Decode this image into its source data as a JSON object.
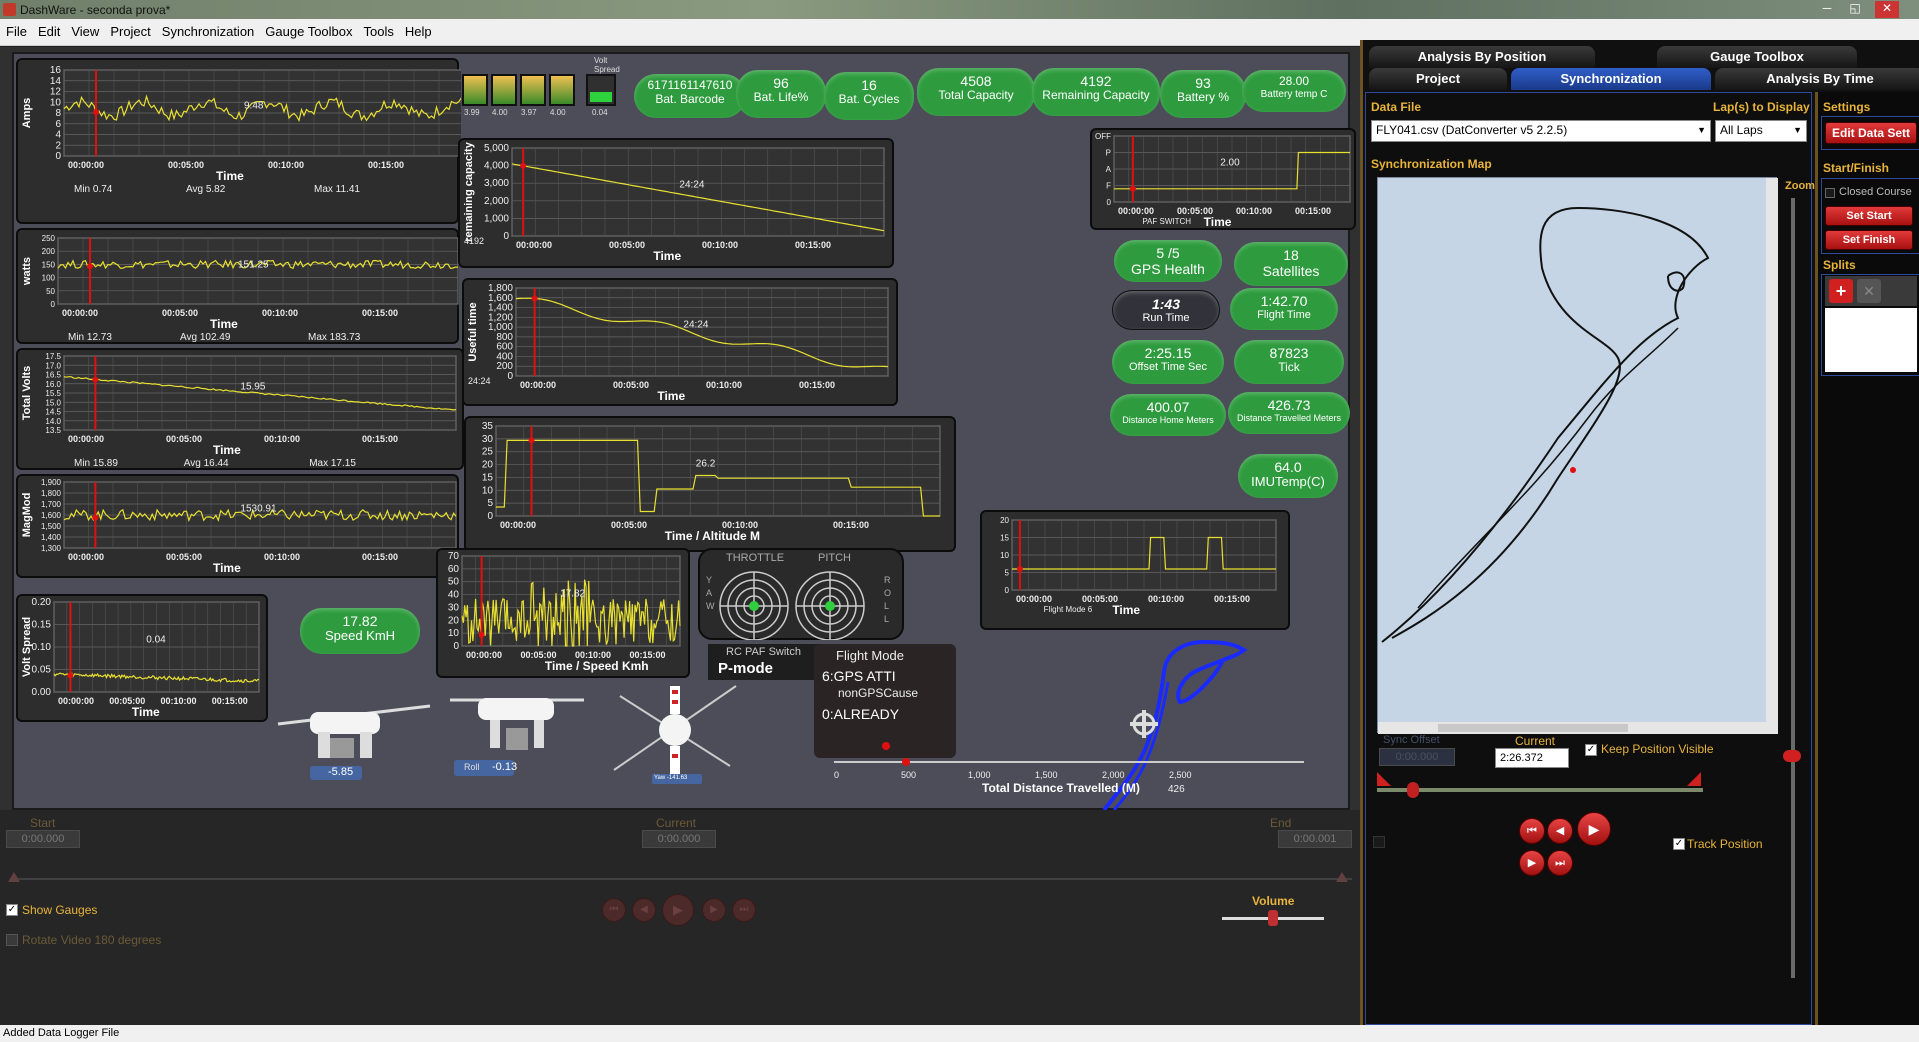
{
  "window": {
    "title": "DashWare - seconda prova*",
    "min_glyph": "─",
    "max_glyph": "◱",
    "close_glyph": "✕"
  },
  "menu": [
    "File",
    "Edit",
    "View",
    "Project",
    "Synchronization",
    "Gauge Toolbox",
    "Tools",
    "Help"
  ],
  "charts": {
    "amps": {
      "ylabel": "Amps",
      "yticks": [
        "16",
        "14",
        "12",
        "10",
        "8",
        "6",
        "4",
        "2",
        "0"
      ],
      "xticks": [
        "00:00:00",
        "00:05:00",
        "00:10:00",
        "00:15:00"
      ],
      "xlabel": "Time",
      "cursor": "9.48",
      "min": "Min  0.74",
      "avg": "Avg  5.82",
      "max": "Max  11.41"
    },
    "watts": {
      "ylabel": "watts",
      "yticks": [
        "250",
        "200",
        "150",
        "100",
        "50",
        "0"
      ],
      "xticks": [
        "00:00:00",
        "00:05:00",
        "00:10:00",
        "00:15:00"
      ],
      "xlabel": "Time",
      "cursor": "151.25",
      "min": "Min  12.73",
      "avg": "Avg  102.49",
      "max": "Max  183.73"
    },
    "volts": {
      "ylabel": "Total Volts",
      "yticks": [
        "17.5",
        "17.0",
        "16.5",
        "16.0",
        "15.5",
        "15.0",
        "14.5",
        "14.0",
        "13.5"
      ],
      "xticks": [
        "00:00:00",
        "00:05:00",
        "00:10:00",
        "00:15:00"
      ],
      "xlabel": "Time",
      "cursor": "15.95",
      "min": "Min  15.89",
      "avg": "Avg  16.44",
      "max": "Max  17.15"
    },
    "magmod": {
      "ylabel": "MagMod",
      "yticks": [
        "1,900",
        "1,800",
        "1,700",
        "1,600",
        "1,500",
        "1,400",
        "1,300"
      ],
      "xticks": [
        "00:00:00",
        "00:05:00",
        "00:10:00",
        "00:15:00"
      ],
      "xlabel": "Time",
      "cursor": "1530.91"
    },
    "voltspread": {
      "ylabel": "Volt Spread",
      "yticks": [
        "0.20",
        "0.15",
        "0.10",
        "0.05",
        "0.00"
      ],
      "xticks": [
        "00:00:00",
        "00:05:00",
        "00:10:00",
        "00:15:00"
      ],
      "xlabel": "Time",
      "cursor": "0.04"
    },
    "remcap": {
      "ylabel": "remaining capacity",
      "yticks": [
        "5,000",
        "4,000",
        "3,000",
        "2,000",
        "1,000",
        "0"
      ],
      "xticks": [
        "00:00:00",
        "00:05:00",
        "00:10:00",
        "00:15:00"
      ],
      "xlabel": "Time",
      "cursor": "24:24",
      "side": "4192"
    },
    "useful": {
      "ylabel": "Useful time",
      "yticks": [
        "1,800",
        "1,600",
        "1,400",
        "1,200",
        "1,000",
        "800",
        "600",
        "400",
        "200",
        "0"
      ],
      "xticks": [
        "00:00:00",
        "00:05:00",
        "00:10:00",
        "00:15:00"
      ],
      "xlabel": "Time",
      "cursor": "24:24",
      "side": "24:24"
    },
    "altitude": {
      "yticks": [
        "35",
        "30",
        "25",
        "20",
        "15",
        "10",
        "5",
        "0"
      ],
      "xticks": [
        "00:00:00",
        "00:05:00",
        "00:10:00",
        "00:15:00"
      ],
      "xlabel": "Time  /  Altitude M",
      "cursor": "26.2"
    },
    "speed": {
      "yticks": [
        "70",
        "60",
        "50",
        "40",
        "30",
        "20",
        "10",
        "0"
      ],
      "xticks": [
        "00:00:00",
        "00:05:00",
        "00:10:00",
        "00:15:00"
      ],
      "xlabel": "Time / Speed Kmh",
      "cursor": "17.82"
    },
    "flightmode": {
      "yticks": [
        "20",
        "15",
        "10",
        "5",
        "0"
      ],
      "xticks": [
        "00:00:00",
        "00:05:00",
        "00:10:00",
        "00:15:00"
      ],
      "xlabel": "Time",
      "sub": "Flight Mode  6"
    },
    "paf": {
      "yticks": [
        "OFF",
        "P",
        "A",
        "F",
        "0"
      ],
      "xticks": [
        "00:00:00",
        "00:05:00",
        "00:10:00",
        "00:15:00"
      ],
      "xlabel": "Time",
      "sub": "PAF SWITCH",
      "cursor": "2.00"
    }
  },
  "cells": {
    "title": "Volt Spread",
    "labels": [
      "3.99",
      "4.00",
      "3.97",
      "4.00"
    ],
    "spread": "0.04"
  },
  "pills": {
    "barcode": {
      "v": "6171161147610",
      "l": "Bat. Barcode"
    },
    "life": {
      "v": "96",
      "l": "Bat. Life%"
    },
    "cycles": {
      "v": "16",
      "l": "Bat. Cycles"
    },
    "totalcap": {
      "v": "4508",
      "l": "Total Capacity"
    },
    "remcap": {
      "v": "4192",
      "l": "Remaining Capacity"
    },
    "battery": {
      "v": "93",
      "l": "Battery %"
    },
    "battemp": {
      "v": "28.00",
      "l": "Battery temp C"
    },
    "gps": {
      "v": "5 /5",
      "l": "GPS Health"
    },
    "sats": {
      "v": "18",
      "l": "Satellites"
    },
    "runtime": {
      "v": "1:43",
      "l": "Run Time"
    },
    "flighttime": {
      "v": "1:42.70",
      "l": "Flight Time"
    },
    "offset": {
      "v": "2:25.15",
      "l": "Offset Time Sec"
    },
    "tick": {
      "v": "87823",
      "l": "Tick"
    },
    "disthome": {
      "v": "400.07",
      "l": "Distance Home Meters"
    },
    "disttrav": {
      "v": "426.73",
      "l": "Distance Travelled Meters"
    },
    "imu": {
      "v": "64.0",
      "l": "IMUTemp(C)"
    },
    "speed": {
      "v": "17.82",
      "l": "Speed KmH"
    }
  },
  "sticks": {
    "throttle": "THROTTLE",
    "pitch": "PITCH",
    "yaw": "Y A W",
    "roll": "R O L L"
  },
  "rcpaf": {
    "label": "RC PAF Switch",
    "value": "P-mode"
  },
  "flightmode": {
    "title": "Flight Mode",
    "l1": "6:GPS ATTI",
    "l2": "nonGPSCause",
    "l3": "0:ALREADY"
  },
  "attitude": {
    "pitch": "-5.85",
    "roll_label": "Roll",
    "roll": "-0.13",
    "yaw": "Yaw -141.63"
  },
  "distbar": {
    "ticks": [
      "0",
      "500",
      "1,000",
      "1,500",
      "2,000",
      "2,500"
    ],
    "label": "Total Distance Travelled (M)",
    "value": "426"
  },
  "controls": {
    "start_label": "Start",
    "start_val": "0:00.000",
    "current_label": "Current",
    "current_val": "0:00.000",
    "end_label": "End",
    "end_val": "0:00.001",
    "show_gauges": "Show Gauges",
    "rotate": "Rotate Video 180 degrees",
    "volume": "Volume"
  },
  "status": "Added Data Logger File",
  "tabs": {
    "analysis_pos": "Analysis By Position",
    "gauge_toolbox": "Gauge Toolbox",
    "project": "Project",
    "sync": "Synchronization",
    "analysis_time": "Analysis By Time"
  },
  "sync": {
    "datafile_label": "Data File",
    "datafile": "FLY041.csv (DatConverter v5 2.2.5)",
    "laps_label": "Lap(s) to Display",
    "laps": "All Laps",
    "map_label": "Synchronization Map",
    "zoom": "Zoom",
    "sync_offset_label": "Sync Offset",
    "sync_offset": "0:00.000",
    "current_label": "Current",
    "current": "2:26.372",
    "keep_visible": "Keep Position Visible",
    "track": "Track Position"
  },
  "settings": {
    "label": "Settings",
    "edit": "Edit Data Sett",
    "startfinish": "Start/Finish",
    "closed": "Closed Course",
    "set_start": "Set Start",
    "set_finish": "Set Finish",
    "splits": "Splits"
  },
  "colors": {
    "trace": "#e8e030",
    "pill": "#2e9c3e",
    "tab_active": "#2f5ec8",
    "accent": "#e8b43a",
    "marker": "#e01010"
  }
}
